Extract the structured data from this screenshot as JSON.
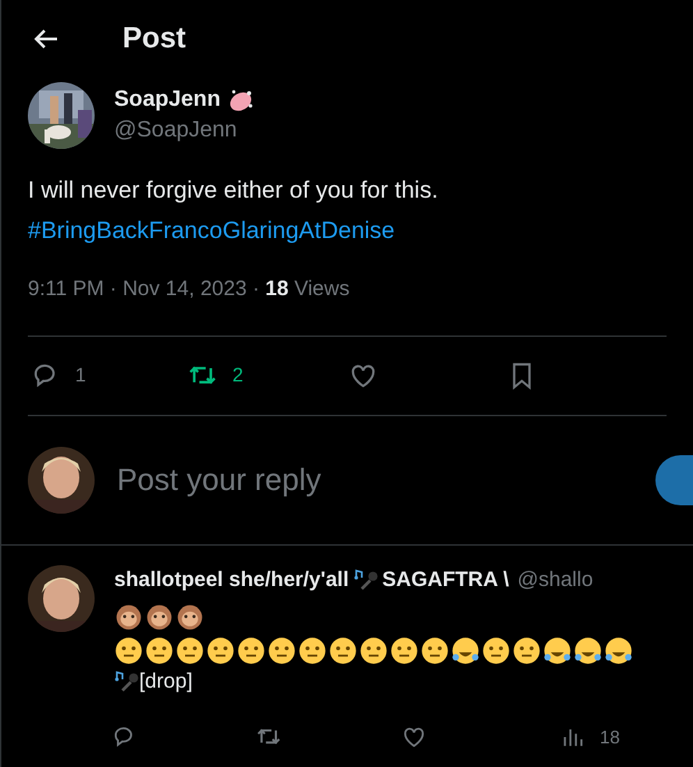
{
  "header": {
    "title": "Post"
  },
  "post": {
    "author": {
      "name": "SoapJenn",
      "handle": "@SoapJenn"
    },
    "text_lines": [
      {
        "kind": "plain",
        "text": "I will never forgive either of you for this."
      },
      {
        "kind": "hashtag",
        "text": "#BringBackFrancoGlaringAtDenise"
      }
    ],
    "time": "9:11 PM · Nov 14, 2023 · ",
    "views_count": "18",
    "views_label": " Views",
    "actions": [
      {
        "kind": "reply",
        "count": "1",
        "selected": false
      },
      {
        "kind": "repost",
        "count": "2",
        "selected": true
      },
      {
        "kind": "like",
        "selected": false
      },
      {
        "kind": "bookmark",
        "selected": false
      }
    ]
  },
  "composer": {
    "placeholder": "Post your reply"
  },
  "reply": {
    "name": "shallotpeel she/her/y'all",
    "name_suffix": "SAGAFTRA \\",
    "handle": "@shallo",
    "emoji_rows": [
      [
        {
          "kind": "monkey"
        },
        {
          "kind": "monkey"
        },
        {
          "kind": "monkey"
        }
      ],
      [
        {
          "kind": "face"
        },
        {
          "kind": "face"
        },
        {
          "kind": "face"
        },
        {
          "kind": "face"
        },
        {
          "kind": "face"
        },
        {
          "kind": "face"
        },
        {
          "kind": "face"
        },
        {
          "kind": "face"
        },
        {
          "kind": "face"
        },
        {
          "kind": "face"
        },
        {
          "kind": "face"
        },
        {
          "kind": "laugh"
        },
        {
          "kind": "face"
        },
        {
          "kind": "face"
        },
        {
          "kind": "laugh"
        },
        {
          "kind": "laugh"
        },
        {
          "kind": "laugh"
        }
      ]
    ],
    "last_line": "[drop]",
    "actions": [
      {
        "kind": "reply"
      },
      {
        "kind": "repost"
      },
      {
        "kind": "like"
      },
      {
        "kind": "views",
        "count": "18"
      }
    ]
  }
}
